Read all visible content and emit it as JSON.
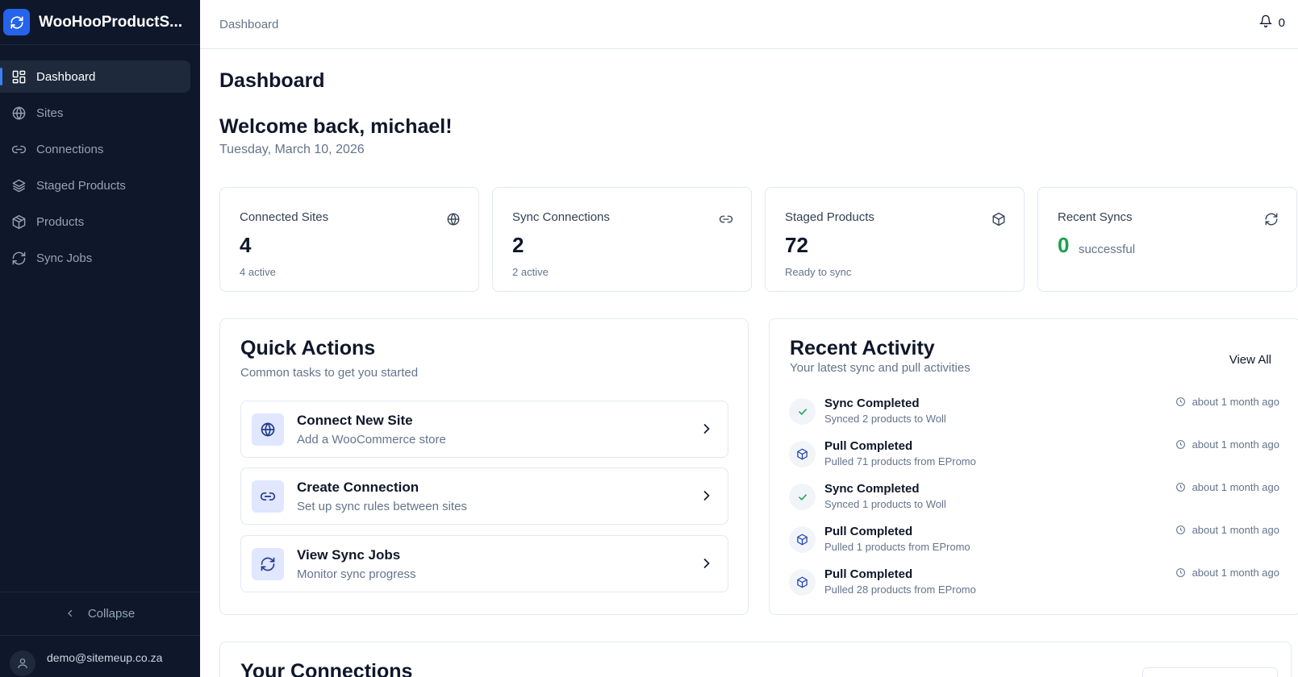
{
  "app": {
    "name": "WooHooProductS..."
  },
  "sidebar": {
    "items": [
      {
        "label": "Dashboard",
        "icon": "layout-dashboard-icon",
        "active": true
      },
      {
        "label": "Sites",
        "icon": "globe-icon",
        "active": false
      },
      {
        "label": "Connections",
        "icon": "link-icon",
        "active": false
      },
      {
        "label": "Staged Products",
        "icon": "layers-icon",
        "active": false
      },
      {
        "label": "Products",
        "icon": "package-icon",
        "active": false
      },
      {
        "label": "Sync Jobs",
        "icon": "refresh-icon",
        "active": false
      }
    ],
    "collapse_label": "Collapse",
    "user_email": "demo@sitemeup.co.za"
  },
  "topbar": {
    "breadcrumb": "Dashboard",
    "notifications": "0"
  },
  "page": {
    "title": "Dashboard",
    "welcome": "Welcome back, michael!",
    "date": "Tuesday, March 10, 2026"
  },
  "stats": [
    {
      "label": "Connected Sites",
      "value": "4",
      "sub": "4 active",
      "icon": "globe-icon"
    },
    {
      "label": "Sync Connections",
      "value": "2",
      "sub": "2 active",
      "icon": "link-icon"
    },
    {
      "label": "Staged Products",
      "value": "72",
      "sub": "Ready to sync",
      "icon": "package-icon"
    },
    {
      "label": "Recent Syncs",
      "value": "0",
      "suffix": "successful",
      "icon": "refresh-icon"
    }
  ],
  "quick_actions": {
    "title": "Quick Actions",
    "subtitle": "Common tasks to get you started",
    "items": [
      {
        "title": "Connect New Site",
        "desc": "Add a WooCommerce store",
        "icon": "globe-icon"
      },
      {
        "title": "Create Connection",
        "desc": "Set up sync rules between sites",
        "icon": "link-icon"
      },
      {
        "title": "View Sync Jobs",
        "desc": "Monitor sync progress",
        "icon": "refresh-icon"
      }
    ]
  },
  "recent_activity": {
    "title": "Recent Activity",
    "subtitle": "Your latest sync and pull activities",
    "view_all": "View All",
    "items": [
      {
        "title": "Sync Completed",
        "desc": "Synced 2 products to Woll",
        "time": "about 1 month ago",
        "icon": "check-icon"
      },
      {
        "title": "Pull Completed",
        "desc": "Pulled 71 products from EPromo",
        "time": "about 1 month ago",
        "icon": "package-icon"
      },
      {
        "title": "Sync Completed",
        "desc": "Synced 1 products to Woll",
        "time": "about 1 month ago",
        "icon": "check-icon"
      },
      {
        "title": "Pull Completed",
        "desc": "Pulled 1 products from EPromo",
        "time": "about 1 month ago",
        "icon": "package-icon"
      },
      {
        "title": "Pull Completed",
        "desc": "Pulled 28 products from EPromo",
        "time": "about 1 month ago",
        "icon": "package-icon"
      }
    ]
  },
  "connections": {
    "title": "Your Connections"
  },
  "colors": {
    "sidebar_bg": "#0f172a",
    "accent": "#2563eb",
    "success": "#16a34a"
  }
}
